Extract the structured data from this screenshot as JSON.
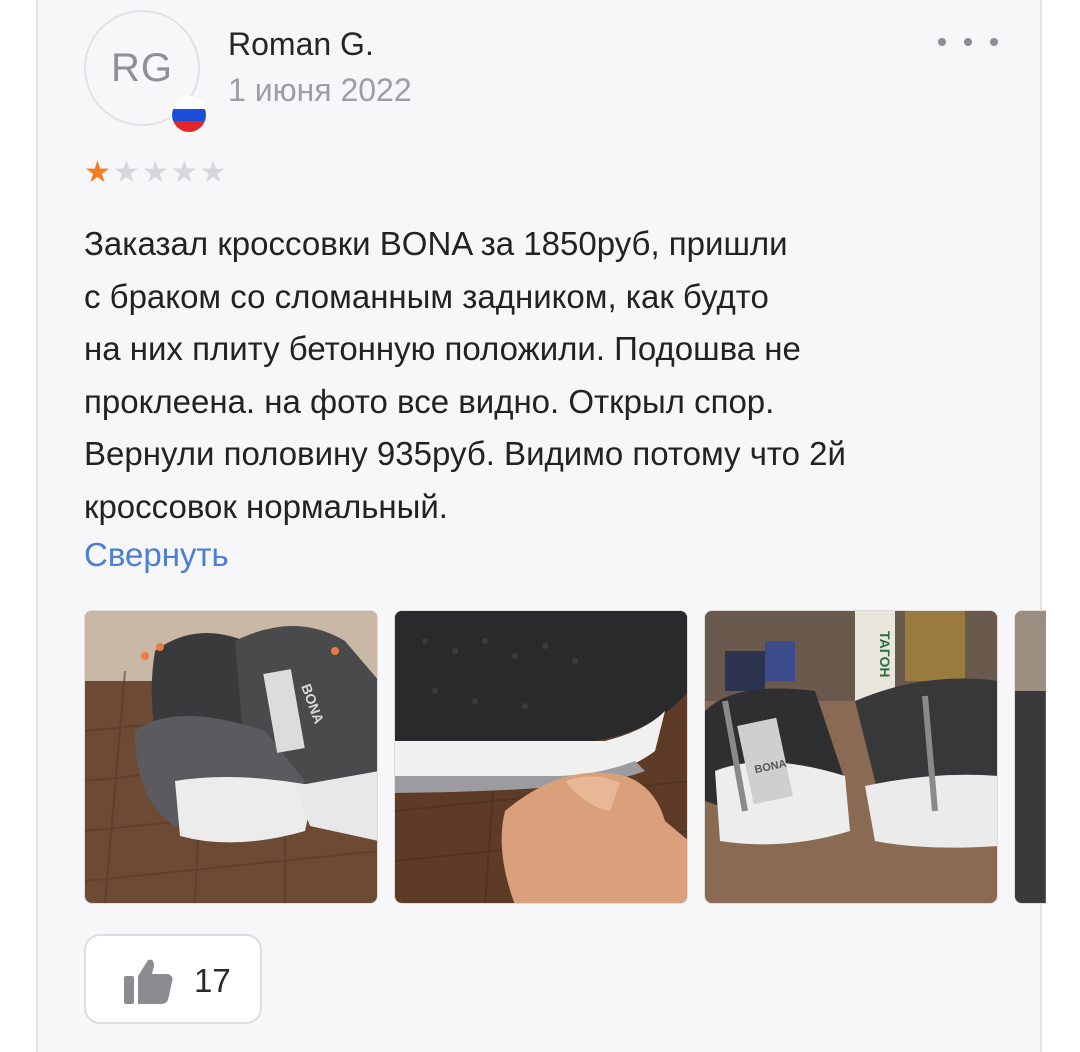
{
  "review": {
    "author_initials": "RG",
    "author_name": "Roman G.",
    "date": "1 июня 2022",
    "country_flag": "russia-flag-icon",
    "rating": 1,
    "rating_max": 5,
    "text_lines": [
      "Заказал кроссовки BONA за 1850руб, пришли",
      "с браком со сломанным задником, как будто",
      "на них плиту бетонную положили. Подошва не",
      "проклеена. на фото все видно. Открыл спор.",
      "Вернули половину 935руб. Видимо потому что 2й",
      "кроссовок нормальный."
    ],
    "collapse_label": "Свернуть",
    "likes": "17"
  },
  "photos": [
    {
      "label": "BONA",
      "kind": "sneaker-heel-photo"
    },
    {
      "label": "",
      "kind": "sneaker-sole-photo"
    },
    {
      "label": "ТАГОН",
      "tag_label": "BONA",
      "kind": "sneakers-on-table-photo"
    },
    {
      "label": "",
      "kind": "partial-photo"
    }
  ],
  "colors": {
    "accent_link": "#4a7fd6",
    "star_active": "#f47c20",
    "star_inactive": "#d7d7db",
    "card_background": "#f7f7f9"
  },
  "icons": {
    "more": "ellipsis-icon",
    "like": "thumbs-up-icon"
  }
}
